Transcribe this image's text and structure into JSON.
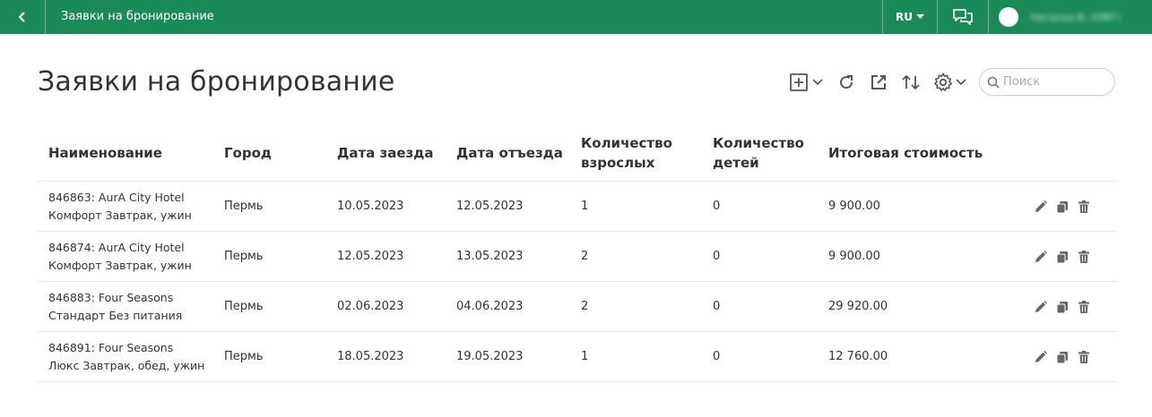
{
  "header": {
    "title": "Заявки на бронирование",
    "lang": "RU",
    "username": "Наталья В. (ОФГ)"
  },
  "page": {
    "title": "Заявки на бронирование",
    "search_placeholder": "Поиск"
  },
  "table": {
    "columns": [
      "Наименование",
      "Город",
      "Дата заезда",
      "Дата отъезда",
      "Количество взрослых",
      "Количество детей",
      "Итоговая стоимость"
    ],
    "rows": [
      {
        "name1": "846863: AurA City Hotel",
        "name2": "Комфорт Завтрак, ужин",
        "city": "Пермь",
        "checkin": "10.05.2023",
        "checkout": "12.05.2023",
        "adults": "1",
        "children": "0",
        "total": "9 900.00"
      },
      {
        "name1": "846874: AurA City Hotel",
        "name2": "Комфорт Завтрак, ужин",
        "city": "Пермь",
        "checkin": "12.05.2023",
        "checkout": "13.05.2023",
        "adults": "2",
        "children": "0",
        "total": "9 900.00"
      },
      {
        "name1": "846883: Four Seasons",
        "name2": "Стандарт Без питания",
        "city": "Пермь",
        "checkin": "02.06.2023",
        "checkout": "04.06.2023",
        "adults": "2",
        "children": "0",
        "total": "29 920.00"
      },
      {
        "name1": "846891: Four Seasons",
        "name2": "Люкс Завтрак, обед, ужин",
        "city": "Пермь",
        "checkin": "18.05.2023",
        "checkout": "19.05.2023",
        "adults": "1",
        "children": "0",
        "total": "12 760.00"
      }
    ]
  },
  "colors": {
    "header_bg": "#1a8a58",
    "icon_gray": "#666666",
    "border": "#e6e6e6"
  },
  "icons": [
    "chevron-left-icon",
    "caret-down-icon",
    "chat-icon",
    "add-icon",
    "refresh-icon",
    "export-icon",
    "sort-icon",
    "gear-icon",
    "search-icon",
    "edit-icon",
    "copy-icon",
    "delete-icon"
  ]
}
